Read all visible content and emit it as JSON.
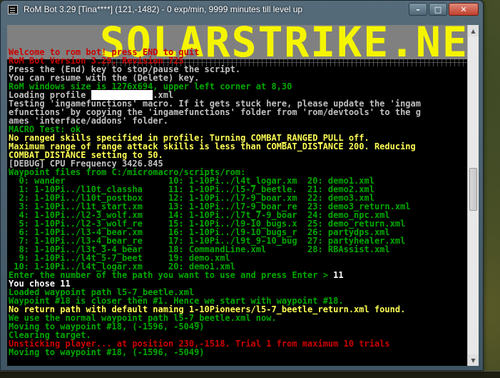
{
  "window": {
    "title": "RoM Bot 3.29 [Tina****] (121,-1482) - 0 exp/min, 9999 minutes till level up",
    "minimize": "–",
    "maximize": "□",
    "close": "✕"
  },
  "banner": {
    "text": "SOLARSTRIKE.NET"
  },
  "console": {
    "lines": [
      {
        "t": "Welcome to rom bot! press END to quit",
        "c": "c-red"
      },
      {
        "t": "RoM Bot Version 3.29, Revision 725",
        "c": "c-red"
      },
      {
        "t": "Press the (End) key to stop/pause the script.",
        "c": "c-white"
      },
      {
        "t": "You can resume with the (Delete) key.",
        "c": "c-white"
      },
      {
        "t": "RoM windows size is 1276x694, upper left corner at 8,30",
        "c": "c-green"
      },
      {
        "t": "Loading profile ",
        "c": "c-white",
        "redact": "XXXXXXXXXXXX",
        "after": ".xml"
      },
      {
        "t": "Testing 'ingamefunctions' macro. If it gets stuck here, please update the 'ingam",
        "c": "c-white"
      },
      {
        "t": "efunctions' by copying the 'ingamefunctions' folder from 'rom/devtools' to the g",
        "c": "c-white"
      },
      {
        "t": "ames 'interface/addons' folder.",
        "c": "c-white"
      },
      {
        "t": "MACRO Test: ok",
        "c": "c-green"
      },
      {
        "t": "No ranged skills specified in profile; Turning COMBAT_RANGED_PULL off.",
        "c": "c-yellow"
      },
      {
        "t": "Maximum range of range attack skills is less than COMBAT_DISTANCE 200. Reducing",
        "c": "c-yellow"
      },
      {
        "t": "COMBAT_DISTANCE setting to 50.",
        "c": "c-yellow"
      },
      {
        "t": "[DEBUG] CPU Frequency 3426.845",
        "c": "c-white"
      },
      {
        "t": "Waypoint files from C:/micromacro/scripts/rom:",
        "c": "c-green"
      },
      {
        "t": "  0: wander                    10: 1-10Pi../l4t_logar.xm  20: demo1.xml",
        "c": "c-green"
      },
      {
        "t": "  1: 1-10Pi../l10t_classha     11: 1-10Pi../l5-7_beetle.  21: demo2.xml",
        "c": "c-green"
      },
      {
        "t": "  2: 1-10Pi../l10t_postbox     12: 1-10Pi../l7-9_boar.xm  22: demo3.xml",
        "c": "c-green"
      },
      {
        "t": "  3: 1-10Pi../l1t_start.xm     13: 1-10Pi../l7-9_boar_re  23: demo3_return.xml",
        "c": "c-green"
      },
      {
        "t": "  4: 1-10Pi../l2-3_wolf.xm     14: 1-10Pi../l7t_7-9_boar  24: demo_npc.xml",
        "c": "c-green"
      },
      {
        "t": "  5: 1-10Pi../l2-3_wolf_re     15: 1-10Pi../l9-10_bugs.x  25: demo_return.xml",
        "c": "c-green"
      },
      {
        "t": "  6: 1-10Pi../l3-4_bear.xm     16: 1-10Pi../l9-10_bugs_r  26: partydps.xml",
        "c": "c-green"
      },
      {
        "t": "  7: 1-10Pi../l3-4_bear_re     17: 1-10Pi../l9t_9-10_bug  27: partyhealer.xml",
        "c": "c-green"
      },
      {
        "t": "  8: 1-10Pi../l3t_3-4_bear     18: CommandLine.xml        28: RBAssist.xml",
        "c": "c-green"
      },
      {
        "t": "  9: 1-10Pi../l4t_5-7_beet     19: demo.xml",
        "c": "c-green"
      },
      {
        "t": " 10: 1-10Pi../l4t_logar.xm     20: demo1.xml",
        "c": "c-green"
      },
      {
        "t": "Enter the number of the path you want to use and press Enter > ",
        "c": "c-green",
        "after": "11",
        "afterClass": "c-bright"
      },
      {
        "t": "You chose 11",
        "c": "c-bright"
      },
      {
        "t": "Loaded waypoint path l5-7_beetle.xml",
        "c": "c-green"
      },
      {
        "t": "Waypoint #18 is closer then #1. Hence we start with waypoint #18.",
        "c": "c-green"
      },
      {
        "t": "No return path with default naming 1-10Pioneers/l5-7_beetle_return.xml found.",
        "c": "c-yellow"
      },
      {
        "t": "We use the normal waypoint path l5-7_beetle.xml now.",
        "c": "c-green"
      },
      {
        "t": "Moving to waypoint #18, (-1596, -5049)",
        "c": "c-green"
      },
      {
        "t": "Clearing target.",
        "c": "c-green"
      },
      {
        "t": "Unsticking player... at position 230,-1518. Trial 1 from maximum 10 trials",
        "c": "c-red"
      },
      {
        "t": "Moving to waypoint #18, (-1596, -5049)",
        "c": "c-green"
      }
    ]
  },
  "scrollbar": {
    "up": "▲",
    "down": "▼"
  }
}
